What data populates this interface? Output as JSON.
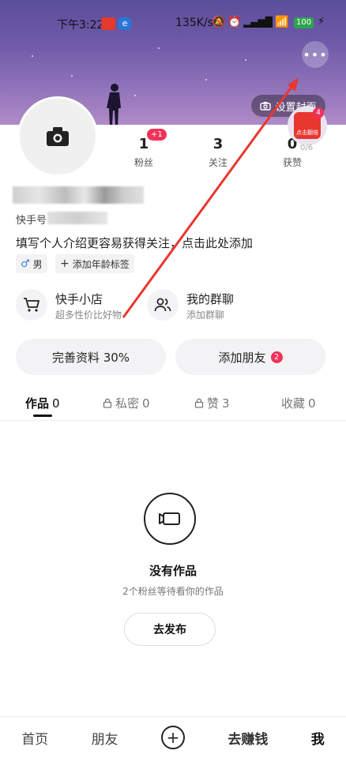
{
  "status_bar": {
    "time": "下午3:22",
    "net_speed": "135K/s",
    "battery": "100"
  },
  "header": {
    "set_cover_label": "设置封面",
    "more_label": "•••"
  },
  "gift": {
    "label": "点击翻倍",
    "count": "4",
    "progress": "0/6"
  },
  "stats": [
    {
      "value": "1",
      "label": "粉丝",
      "badge": "+1"
    },
    {
      "value": "3",
      "label": "关注"
    },
    {
      "value": "0",
      "label": "获赞"
    }
  ],
  "profile": {
    "id_prefix": "快手号",
    "bio": "填写个人介绍更容易获得关注，点击此处添加",
    "gender_tag": "男",
    "age_tag": "添加年龄标签"
  },
  "features": [
    {
      "title": "快手小店",
      "subtitle": "超多性价比好物"
    },
    {
      "title": "我的群聊",
      "subtitle": "添加群聊"
    }
  ],
  "actions": {
    "complete_profile": "完善资料 30%",
    "add_friends": "添加朋友",
    "add_friends_badge": "2"
  },
  "tabs": [
    {
      "label": "作品",
      "count": "0"
    },
    {
      "label": "私密",
      "count": "0"
    },
    {
      "label": "赞",
      "count": "3"
    },
    {
      "label": "收藏",
      "count": "0"
    }
  ],
  "empty_state": {
    "title": "没有作品",
    "subtitle": "2个粉丝等待看你的作品",
    "button": "去发布"
  },
  "bottom_nav": [
    "首页",
    "朋友",
    "去赚钱",
    "我"
  ]
}
